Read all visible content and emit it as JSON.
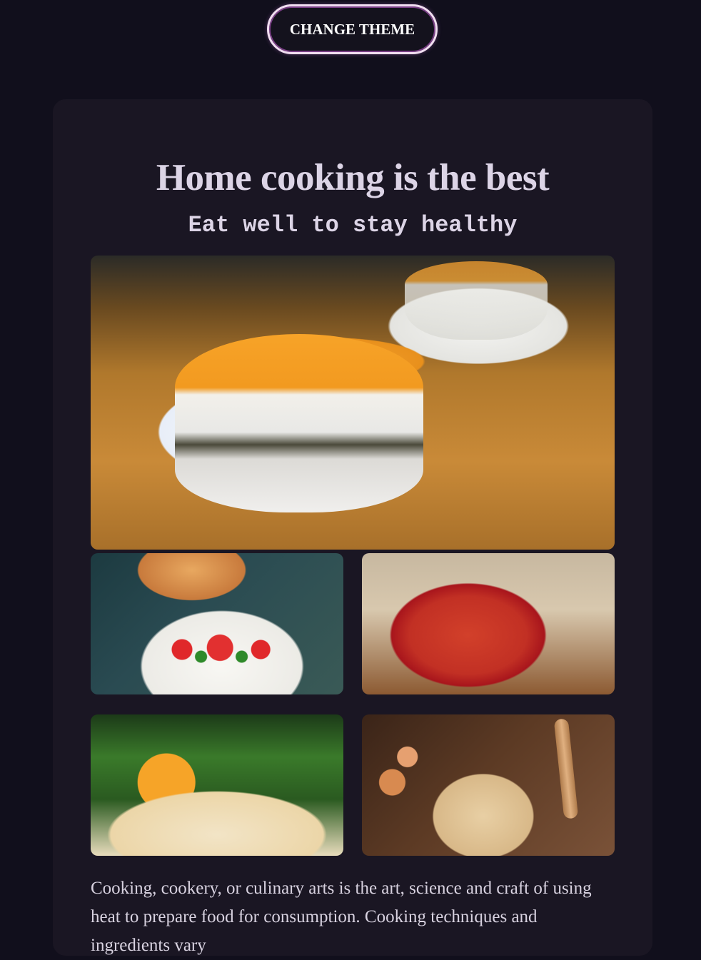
{
  "header": {
    "change_theme_label": "CHANGE THEME"
  },
  "card": {
    "title": "Home cooking is the best",
    "subtitle": "Eat well to stay healthy",
    "body": "Cooking, cookery, or culinary arts is the art, science and craft of using heat to prepare food for consumption. Cooking techniques and ingredients vary"
  },
  "colors": {
    "background": "#110f1c",
    "card": "#1a1623",
    "text": "#dcd4e6",
    "button_border": "#f0ddf0"
  }
}
